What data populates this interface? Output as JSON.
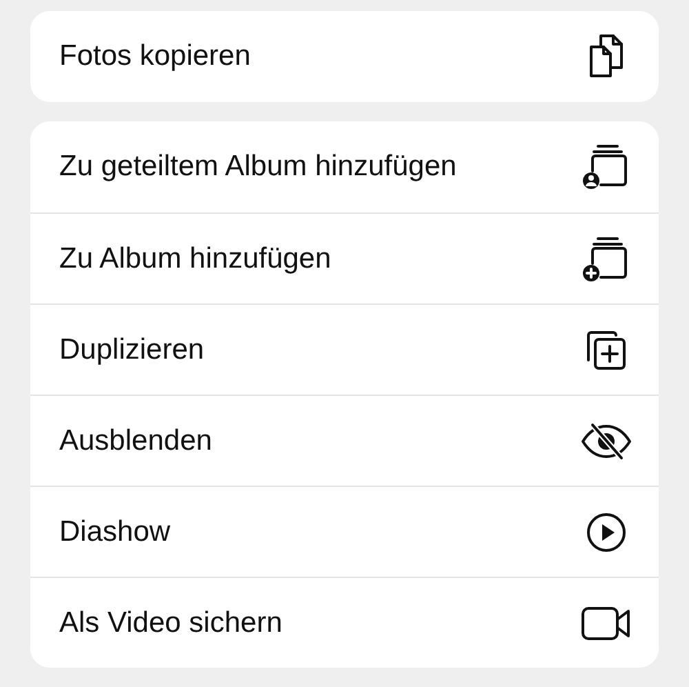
{
  "groups": [
    {
      "items": [
        {
          "label": "Fotos kopieren",
          "kind": "copy"
        }
      ]
    },
    {
      "items": [
        {
          "label": "Zu geteiltem Album hinzufügen",
          "kind": "shared-album"
        },
        {
          "label": "Zu Album hinzufügen",
          "kind": "add-album"
        },
        {
          "label": "Duplizieren",
          "kind": "duplicate"
        },
        {
          "label": "Ausblenden",
          "kind": "hide"
        },
        {
          "label": "Diashow",
          "kind": "play"
        },
        {
          "label": "Als Video sichern",
          "kind": "video"
        }
      ]
    }
  ]
}
